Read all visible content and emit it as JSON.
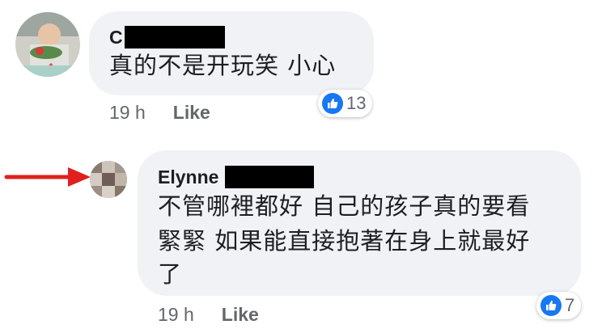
{
  "comments": [
    {
      "author_visible": "C",
      "text": "真的不是开玩笑 小心",
      "time": "19 h",
      "like_label": "Like",
      "reaction_count": "13",
      "reaction_icon": "thumbs-up-icon"
    },
    {
      "author_visible": "Elynne",
      "text_line1": "不管哪裡都好 自己的孩子真的要看",
      "text_line2": "緊緊 如果能直接抱著在身上就最好",
      "text_line3": "了",
      "time": "19 h",
      "like_label": "Like",
      "reaction_count": "7",
      "reaction_icon": "thumbs-up-icon"
    }
  ],
  "colors": {
    "bubble": "#f0f2f5",
    "reaction_blue": "#1877f2",
    "arrow_red": "#e0201e",
    "meta_gray": "#65676b"
  }
}
